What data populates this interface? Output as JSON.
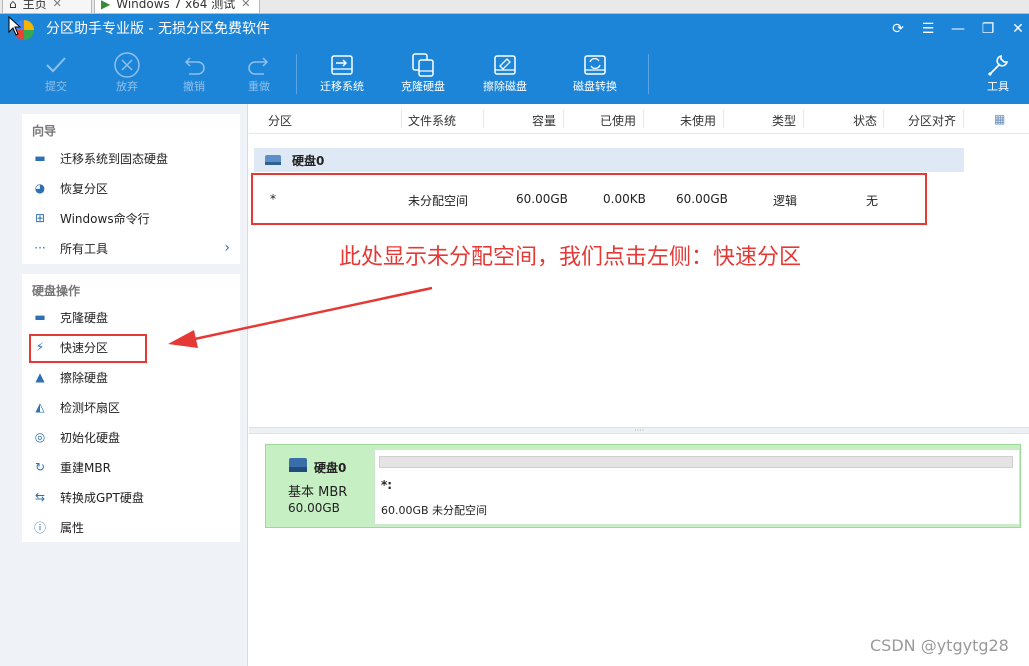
{
  "host_tabs": [
    {
      "label": "主页"
    },
    {
      "label": "Windows 7 x64 测试"
    }
  ],
  "window": {
    "title": "分区助手专业版 - 无损分区免费软件"
  },
  "toolbar": {
    "submit": "提交",
    "discard": "放弃",
    "undo": "撤销",
    "redo": "重做",
    "migrate": "迁移系统",
    "clone": "克隆硬盘",
    "wipe": "擦除磁盘",
    "convert": "磁盘转换",
    "tools": "工具"
  },
  "guide": {
    "title": "向导",
    "items": [
      {
        "label": "迁移系统到固态硬盘"
      },
      {
        "label": "恢复分区"
      },
      {
        "label": "Windows命令行"
      },
      {
        "label": "所有工具"
      }
    ]
  },
  "disk_ops": {
    "title": "硬盘操作",
    "items": [
      {
        "label": "克隆硬盘"
      },
      {
        "label": "快速分区"
      },
      {
        "label": "擦除硬盘"
      },
      {
        "label": "检测坏扇区"
      },
      {
        "label": "初始化硬盘"
      },
      {
        "label": "重建MBR"
      },
      {
        "label": "转换成GPT硬盘"
      },
      {
        "label": "属性"
      }
    ]
  },
  "columns": {
    "partition": "分区",
    "fs": "文件系统",
    "capacity": "容量",
    "used": "已使用",
    "unused": "未使用",
    "type": "类型",
    "status": "状态",
    "align": "分区对齐"
  },
  "disk0": {
    "label": "硬盘0"
  },
  "partition_row": {
    "name": "*",
    "fs": "未分配空间",
    "capacity": "60.00GB",
    "used": "0.00KB",
    "unused": "60.00GB",
    "type": "逻辑",
    "status": "无"
  },
  "annotation": "此处显示未分配空间，我们点击左侧：快速分区",
  "disk_map": {
    "name": "硬盘0",
    "type": "基本 MBR",
    "size": "60.00GB",
    "partition_name": "*:",
    "partition_desc": "60.00GB 未分配空间"
  },
  "watermark": "CSDN @ytgytg28",
  "colors": {
    "titlebar": "#1d85d8",
    "highlight": "#e53935",
    "disk_map_bg": "#c7efc4"
  }
}
